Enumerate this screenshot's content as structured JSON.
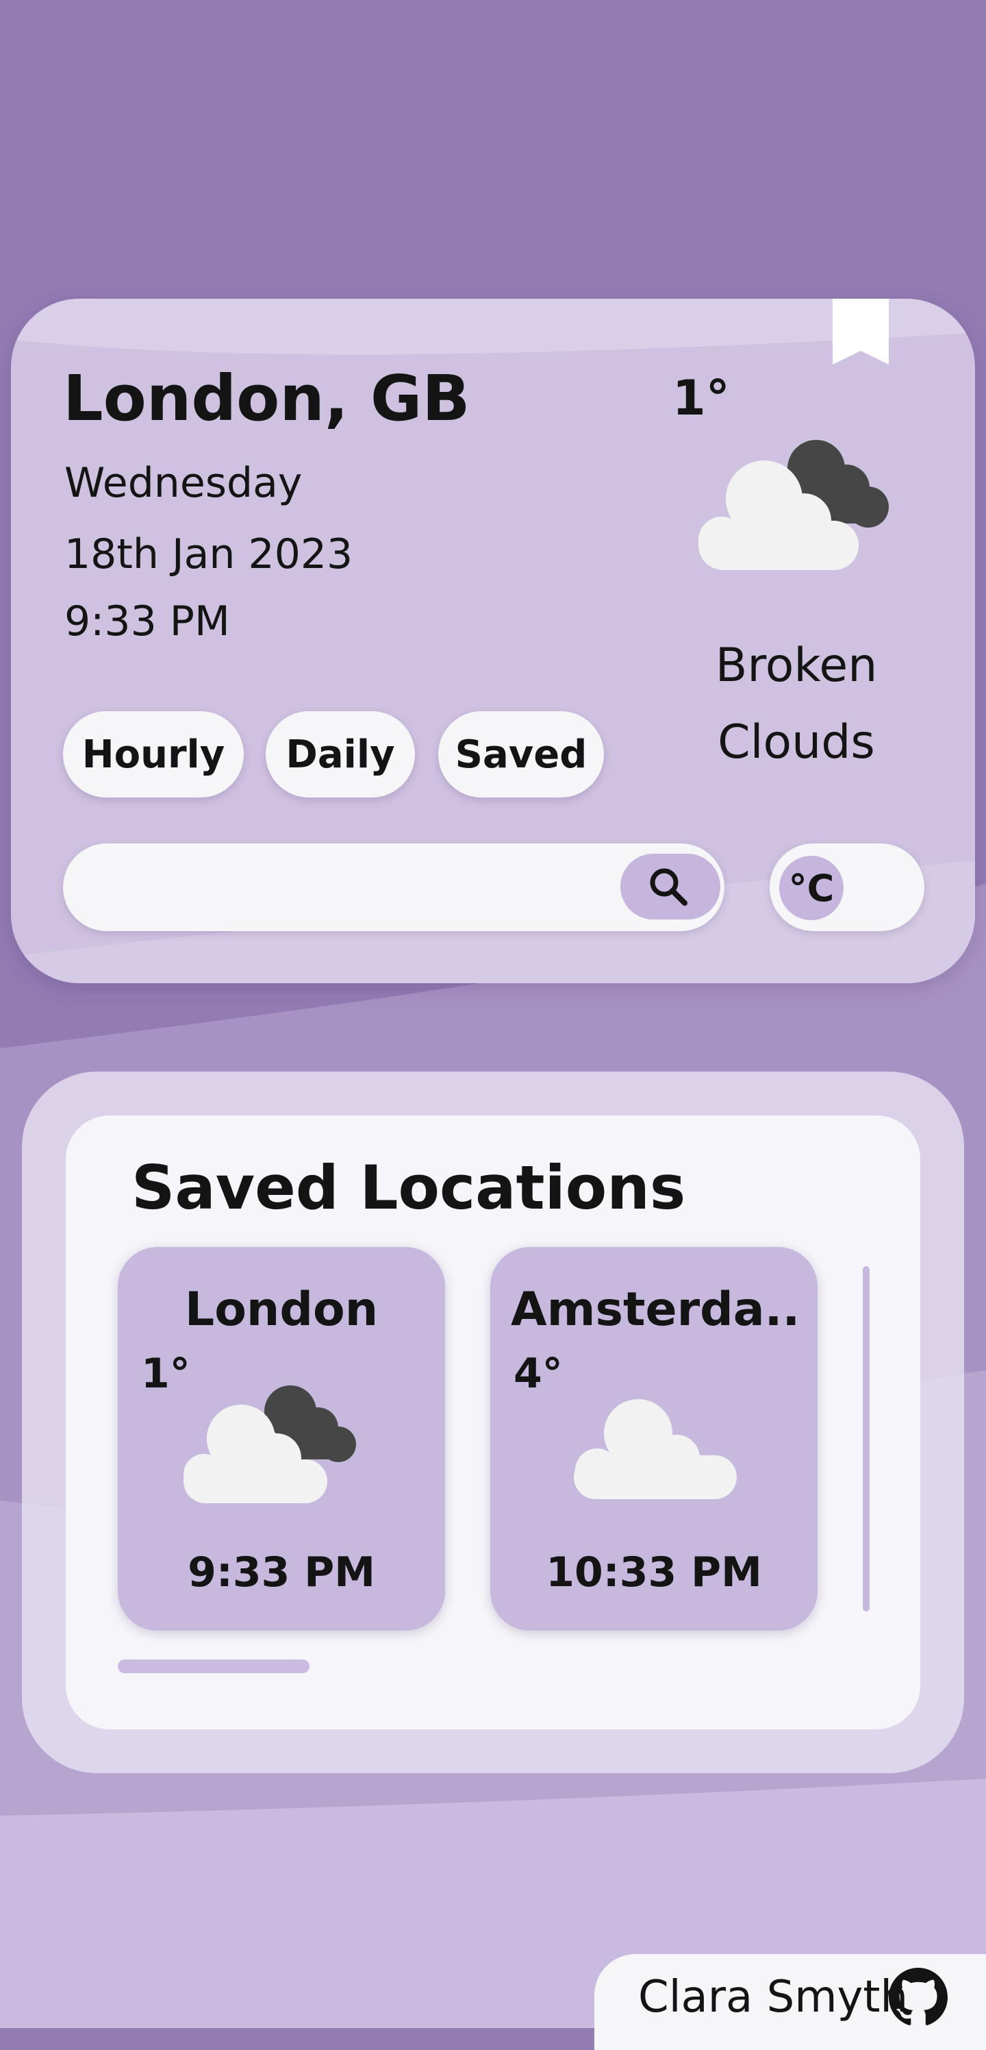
{
  "current": {
    "city": "London, GB",
    "weekday": "Wednesday",
    "date": "18th Jan 2023",
    "time": "9:33 PM",
    "temperature": "1°",
    "condition_line1": "Broken",
    "condition_line2": "Clouds",
    "icon": "broken-clouds-icon"
  },
  "tabs": [
    {
      "label": "Hourly"
    },
    {
      "label": "Daily"
    },
    {
      "label": "Saved"
    }
  ],
  "search": {
    "value": "",
    "placeholder": ""
  },
  "unit": {
    "label": "°C"
  },
  "saved": {
    "title": "Saved Locations",
    "locations": [
      {
        "name": "London",
        "temperature": "1°",
        "time": "9:33 PM",
        "icon": "broken-clouds-icon"
      },
      {
        "name": "Amsterda...",
        "temperature": "4°",
        "time": "10:33 PM",
        "icon": "cloud-icon"
      }
    ]
  },
  "footer": {
    "author": "Clara Smyth",
    "icon": "github-icon"
  },
  "colors": {
    "background": "#927cb2",
    "card": "#cfc2e0",
    "accent": "#c6b5dd",
    "pill": "#f6f5f8",
    "dark_cloud": "#464646",
    "light_cloud": "#f2f2f2"
  }
}
